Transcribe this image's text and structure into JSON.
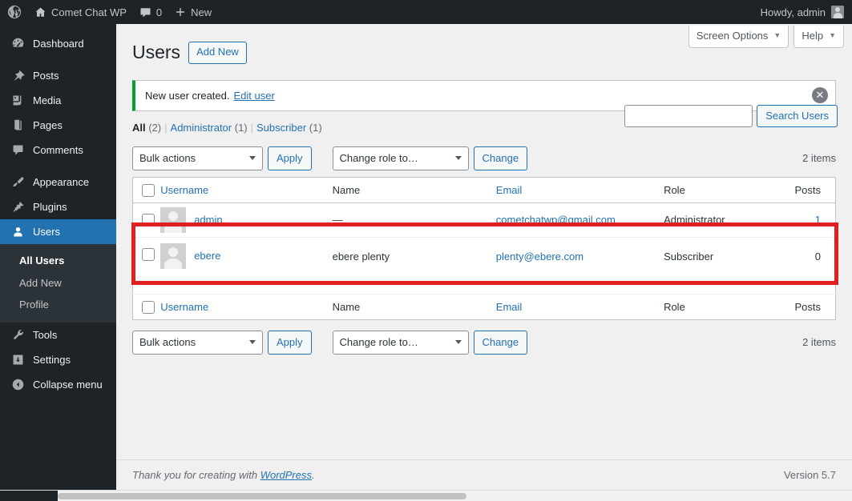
{
  "adminbar": {
    "logo_icon": "wordpress-logo-icon",
    "site_icon": "home-icon",
    "site_name": "Comet Chat WP",
    "comments_icon": "comment-bubble-icon",
    "comments_count": "0",
    "new_icon": "plus-icon",
    "new_label": "New",
    "howdy": "Howdy, admin",
    "avatar_icon": "user-avatar-icon"
  },
  "sidebar": {
    "items": [
      {
        "label": "Dashboard",
        "icon": "dashboard-icon"
      },
      {
        "label": "Posts",
        "icon": "pin-icon"
      },
      {
        "label": "Media",
        "icon": "media-icon"
      },
      {
        "label": "Pages",
        "icon": "pages-icon"
      },
      {
        "label": "Comments",
        "icon": "comment-icon"
      },
      {
        "label": "Appearance",
        "icon": "paintbrush-icon"
      },
      {
        "label": "Plugins",
        "icon": "plug-icon"
      },
      {
        "label": "Users",
        "icon": "user-icon"
      },
      {
        "label": "Tools",
        "icon": "wrench-icon"
      },
      {
        "label": "Settings",
        "icon": "settings-icon"
      },
      {
        "label": "Collapse menu",
        "icon": "collapse-arrow-icon"
      }
    ],
    "submenu": [
      {
        "label": "All Users"
      },
      {
        "label": "Add New"
      },
      {
        "label": "Profile"
      }
    ],
    "active_item": "Users",
    "active_color": "#2271b1"
  },
  "screen_meta": {
    "screen_options": "Screen Options",
    "help": "Help",
    "caret": "▼"
  },
  "page": {
    "title": "Users",
    "add_new_label": "Add New"
  },
  "notice": {
    "message": "New user created.",
    "link_label": "Edit user",
    "dismiss_icon": "close-icon",
    "accent_color": "#00a32a"
  },
  "filters": {
    "all_label": "All",
    "all_count": "(2)",
    "administrator_label": "Administrator",
    "administrator_count": "(1)",
    "subscriber_label": "Subscriber",
    "subscriber_count": "(1)",
    "separator": "|"
  },
  "search": {
    "value": "",
    "placeholder": "",
    "button_label": "Search Users"
  },
  "tablenav": {
    "bulk_actions_label": "Bulk actions",
    "apply_label": "Apply",
    "change_role_label": "Change role to…",
    "change_label": "Change",
    "items_count": "2 items"
  },
  "table": {
    "columns": {
      "username": "Username",
      "name": "Name",
      "email": "Email",
      "role": "Role",
      "posts": "Posts"
    },
    "rows": [
      {
        "username": "admin",
        "name": "—",
        "email": "cometchatwp@gmail.com",
        "role": "Administrator",
        "posts": "1",
        "highlighted": false
      },
      {
        "username": "ebere",
        "name": "ebere plenty",
        "email": "plenty@ebere.com",
        "role": "Subscriber",
        "posts": "0",
        "highlighted": true
      }
    ]
  },
  "annotation": {
    "color": "#e02020",
    "target": "ebere-user-row"
  },
  "footer": {
    "thanks_prefix": "Thank you for creating with",
    "wordpress_link": "WordPress",
    "thanks_suffix": ".",
    "version": "Version 5.7"
  }
}
